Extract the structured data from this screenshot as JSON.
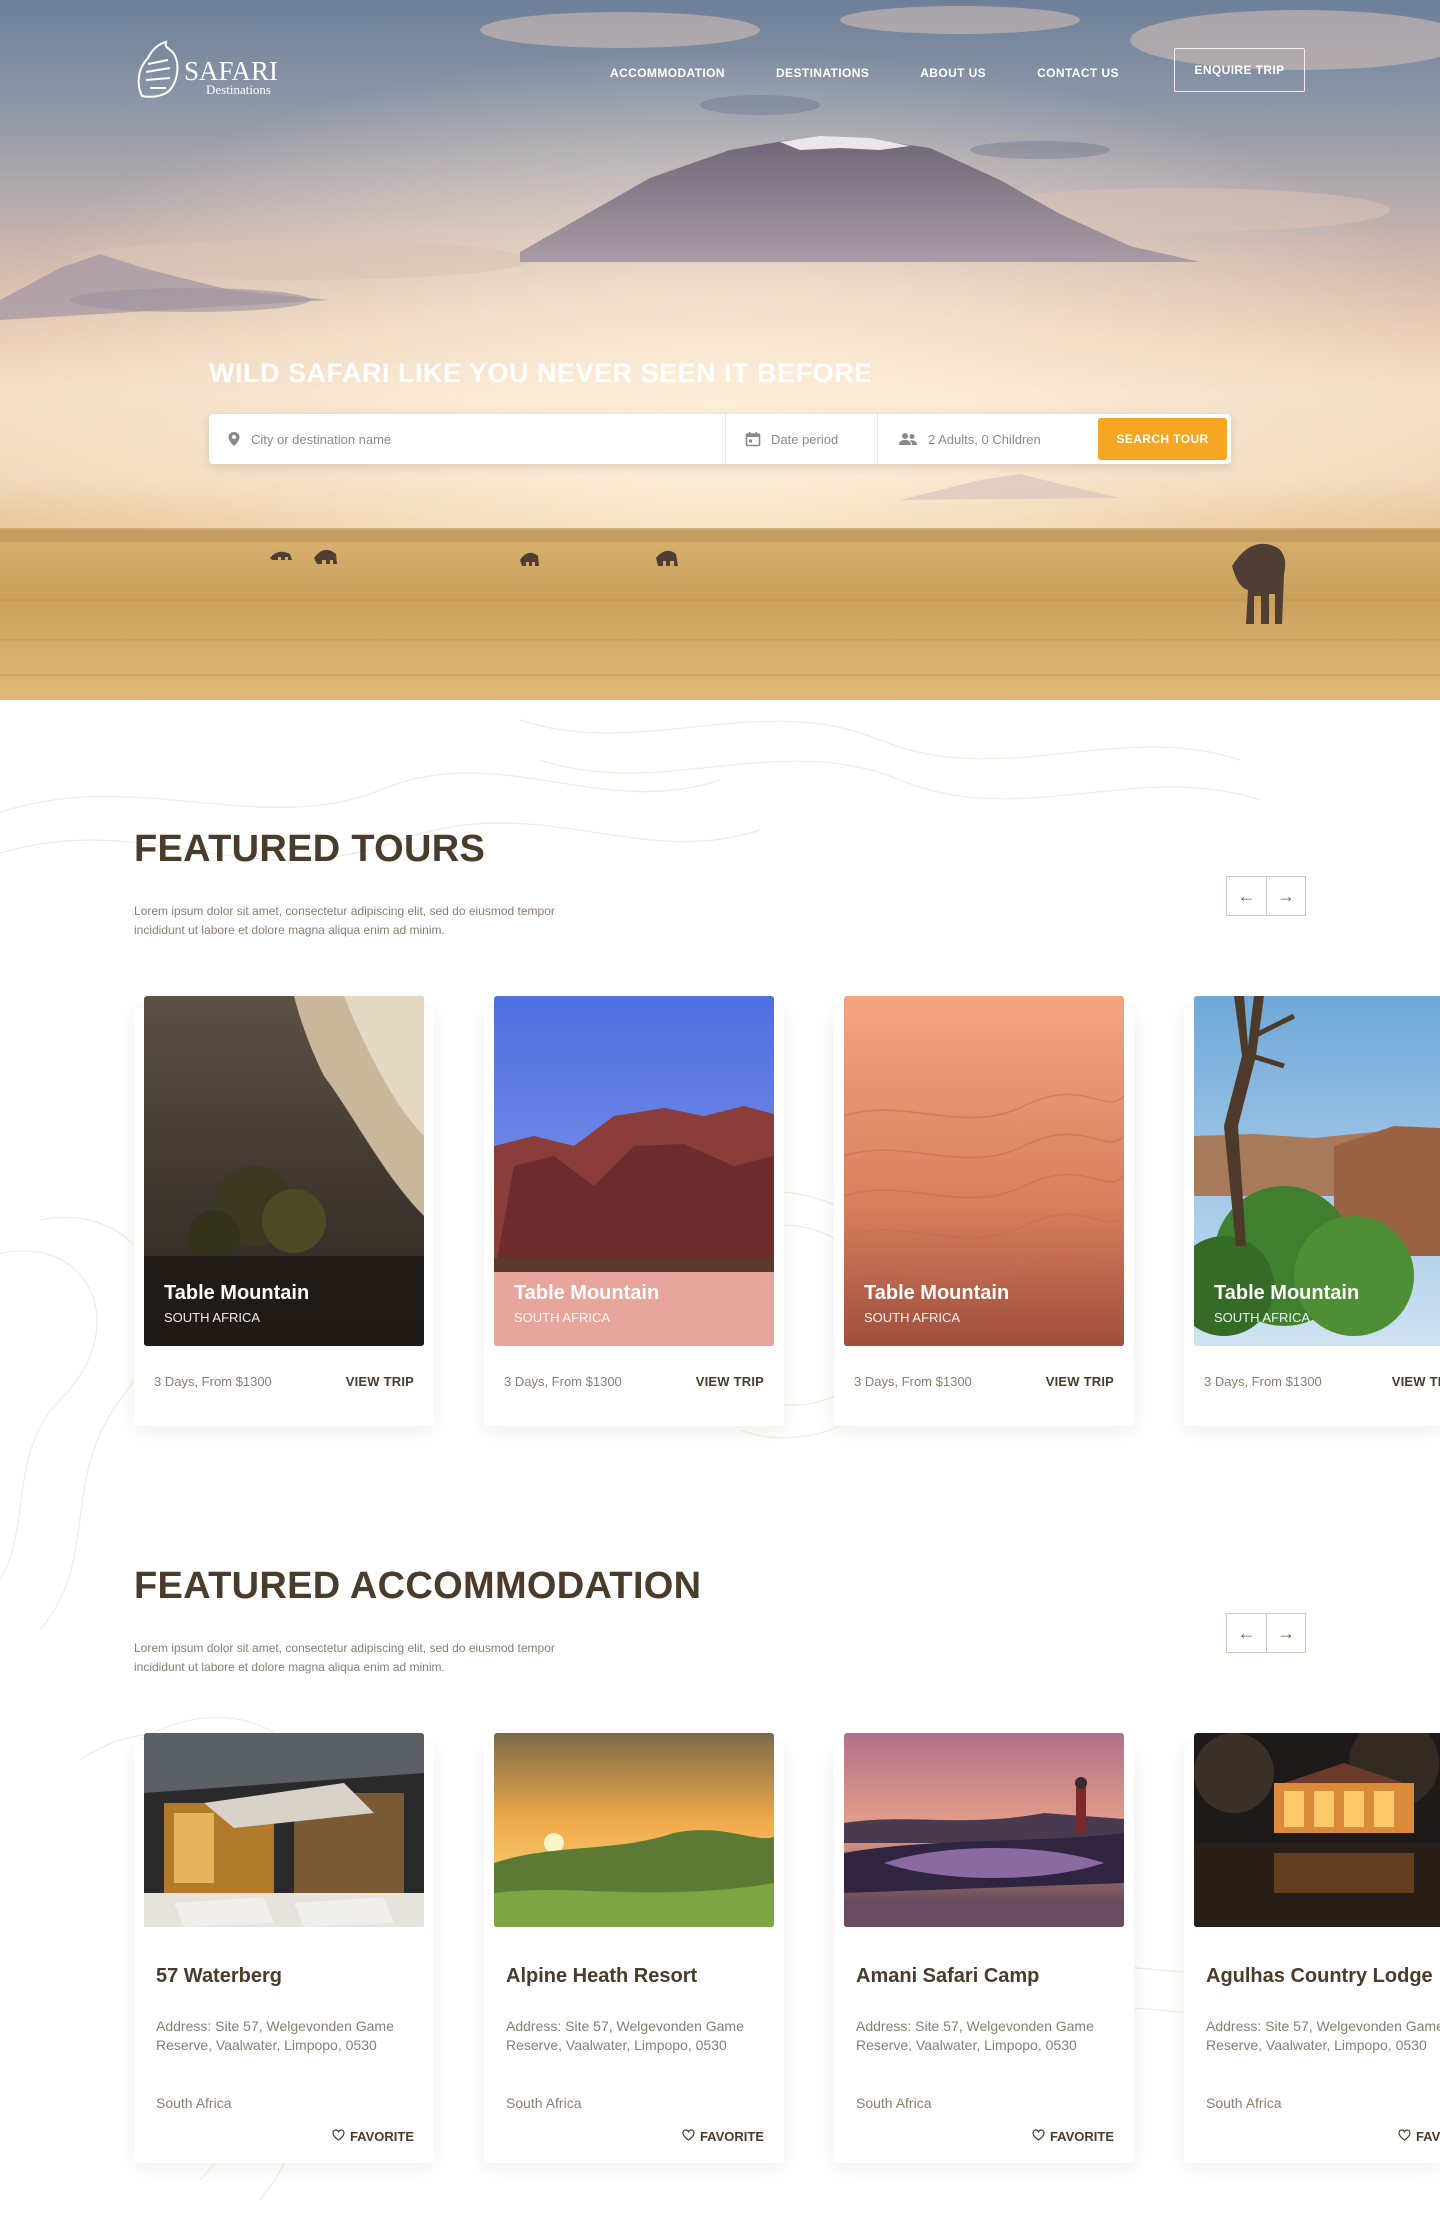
{
  "brand": {
    "name": "SAFARI",
    "sub": "Destinations",
    "accent": "#f5a623",
    "dark": "#4a3b2a"
  },
  "nav": {
    "items": [
      {
        "label": "ACCOMMODATION",
        "icon": ""
      },
      {
        "label": "DESTINATIONS"
      },
      {
        "label": "ABOUT US"
      },
      {
        "label": "CONTACT US"
      }
    ],
    "cta": "ENQUIRE TRIP"
  },
  "hero": {
    "headline_bold": "WILD SAFARI",
    "headline_rest": "LIKE YOU NEVER SEEN IT BEFORE",
    "search": {
      "destination_placeholder": "City or destination name",
      "date_placeholder": "Date period",
      "guests_value": "2 Adults, 0 Children",
      "button": "SEARCH TOUR",
      "icons": [
        "location-pin-icon",
        "calendar-icon",
        "people-icon"
      ]
    }
  },
  "tours": {
    "title": "FEATURED TOURS",
    "description": "Lorem ipsum dolor sit amet, consectetur adipiscing elit, sed do eiusmod tempor incididunt ut labore et dolore magna aliqua enim ad minim.",
    "prev_icon": "arrow-left-icon",
    "next_icon": "arrow-right-icon",
    "items": [
      {
        "name": "Table Mountain",
        "country": "SOUTH AFRICA",
        "meta": "3 Days, From $1300",
        "link": "VIEW TRIP"
      },
      {
        "name": "Table Mountain",
        "country": "SOUTH AFRICA",
        "meta": "3 Days, From $1300",
        "link": "VIEW TRIP"
      },
      {
        "name": "Table Mountain",
        "country": "SOUTH AFRICA",
        "meta": "3 Days, From $1300",
        "link": "VIEW TRIP"
      },
      {
        "name": "Table Mountain",
        "country": "SOUTH AFRICA",
        "meta": "3 Days, From $1300",
        "link": "VIEW TRIP"
      }
    ]
  },
  "accommodation": {
    "title": "FEATURED ACCOMMODATION",
    "description": "Lorem ipsum dolor sit amet, consectetur adipiscing elit, sed do eiusmod tempor incididunt ut labore et dolore magna aliqua enim ad minim.",
    "items": [
      {
        "name": "57 Waterberg",
        "address": "Address: Site 57, Welgevonden Game Reserve, Vaalwater, Limpopo, 0530",
        "country": "South Africa",
        "fav": "FAVORITE"
      },
      {
        "name": "Alpine Heath Resort",
        "address": "Address: Site 57, Welgevonden Game Reserve, Vaalwater, Limpopo, 0530",
        "country": "South Africa",
        "fav": "FAVORITE"
      },
      {
        "name": "Amani Safari Camp",
        "address": "Address: Site 57, Welgevonden Game Reserve, Vaalwater, Limpopo, 0530",
        "country": "South Africa",
        "fav": "FAVORITE"
      },
      {
        "name": "Agulhas Country Lodge",
        "address": "Address: Site 57, Welgevonden Game Reserve, Vaalwater, Limpopo, 0530",
        "country": "South Africa",
        "fav": "FAVORITE"
      }
    ]
  }
}
